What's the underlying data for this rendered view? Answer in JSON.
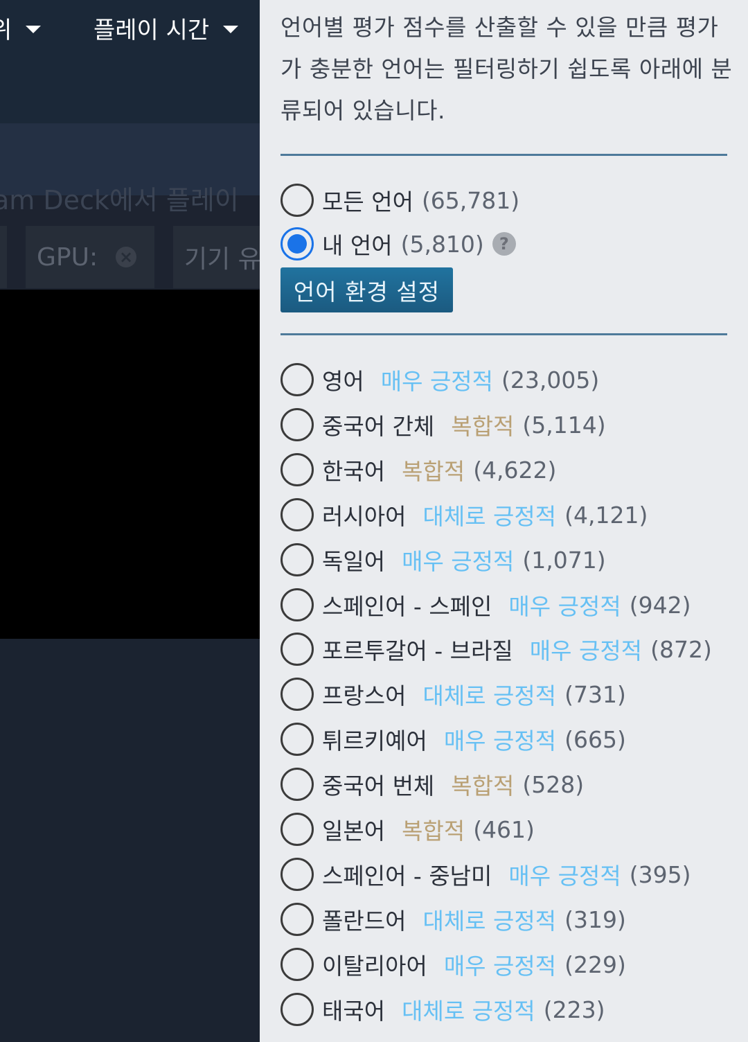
{
  "header": {
    "dropdown_left_label": "위",
    "dropdown_playtime_label": "플레이 시간"
  },
  "background": {
    "deck_text": "am Deck에서 플레이",
    "chip_gpu_label": "GPU:",
    "chip_device_label": "기기 유"
  },
  "language_panel": {
    "description": "언어별 평가 점수를 산출할 수 있을 만큼 평가가 충분한 언어는 필터링하기 쉽도록 아래에 분류되어 있습니다.",
    "all_languages": {
      "label": "모든 언어",
      "count": "(65,781)",
      "selected": false
    },
    "my_language": {
      "label": "내 언어",
      "count": "(5,810)",
      "selected": true,
      "help": "?"
    },
    "preferences_button": "언어 환경 설정",
    "languages": [
      {
        "label": "영어",
        "rating": "매우 긍정적",
        "rating_type": "positive",
        "count": "(23,005)"
      },
      {
        "label": "중국어 간체",
        "rating": "복합적",
        "rating_type": "mixed",
        "count": "(5,114)"
      },
      {
        "label": "한국어",
        "rating": "복합적",
        "rating_type": "mixed",
        "count": "(4,622)"
      },
      {
        "label": "러시아어",
        "rating": "대체로 긍정적",
        "rating_type": "positive",
        "count": "(4,121)"
      },
      {
        "label": "독일어",
        "rating": "매우 긍정적",
        "rating_type": "positive",
        "count": "(1,071)"
      },
      {
        "label": "스페인어 - 스페인",
        "rating": "매우 긍정적",
        "rating_type": "positive",
        "count": "(942)"
      },
      {
        "label": "포르투갈어 - 브라질",
        "rating": "매우 긍정적",
        "rating_type": "positive",
        "count": "(872)"
      },
      {
        "label": "프랑스어",
        "rating": "대체로 긍정적",
        "rating_type": "positive",
        "count": "(731)"
      },
      {
        "label": "튀르키예어",
        "rating": "매우 긍정적",
        "rating_type": "positive",
        "count": "(665)"
      },
      {
        "label": "중국어 번체",
        "rating": "복합적",
        "rating_type": "mixed",
        "count": "(528)"
      },
      {
        "label": "일본어",
        "rating": "복합적",
        "rating_type": "mixed",
        "count": "(461)"
      },
      {
        "label": "스페인어 - 중남미",
        "rating": "매우 긍정적",
        "rating_type": "positive",
        "count": "(395)"
      },
      {
        "label": "폴란드어",
        "rating": "대체로 긍정적",
        "rating_type": "positive",
        "count": "(319)"
      },
      {
        "label": "이탈리아어",
        "rating": "매우 긍정적",
        "rating_type": "positive",
        "count": "(229)"
      },
      {
        "label": "태국어",
        "rating": "대체로 긍정적",
        "rating_type": "positive",
        "count": "(223)"
      }
    ]
  },
  "colors": {
    "positive": "#66c0f4",
    "mixed": "#b9a074",
    "radio_selected": "#1a73e8",
    "button": "#1b5a80"
  }
}
